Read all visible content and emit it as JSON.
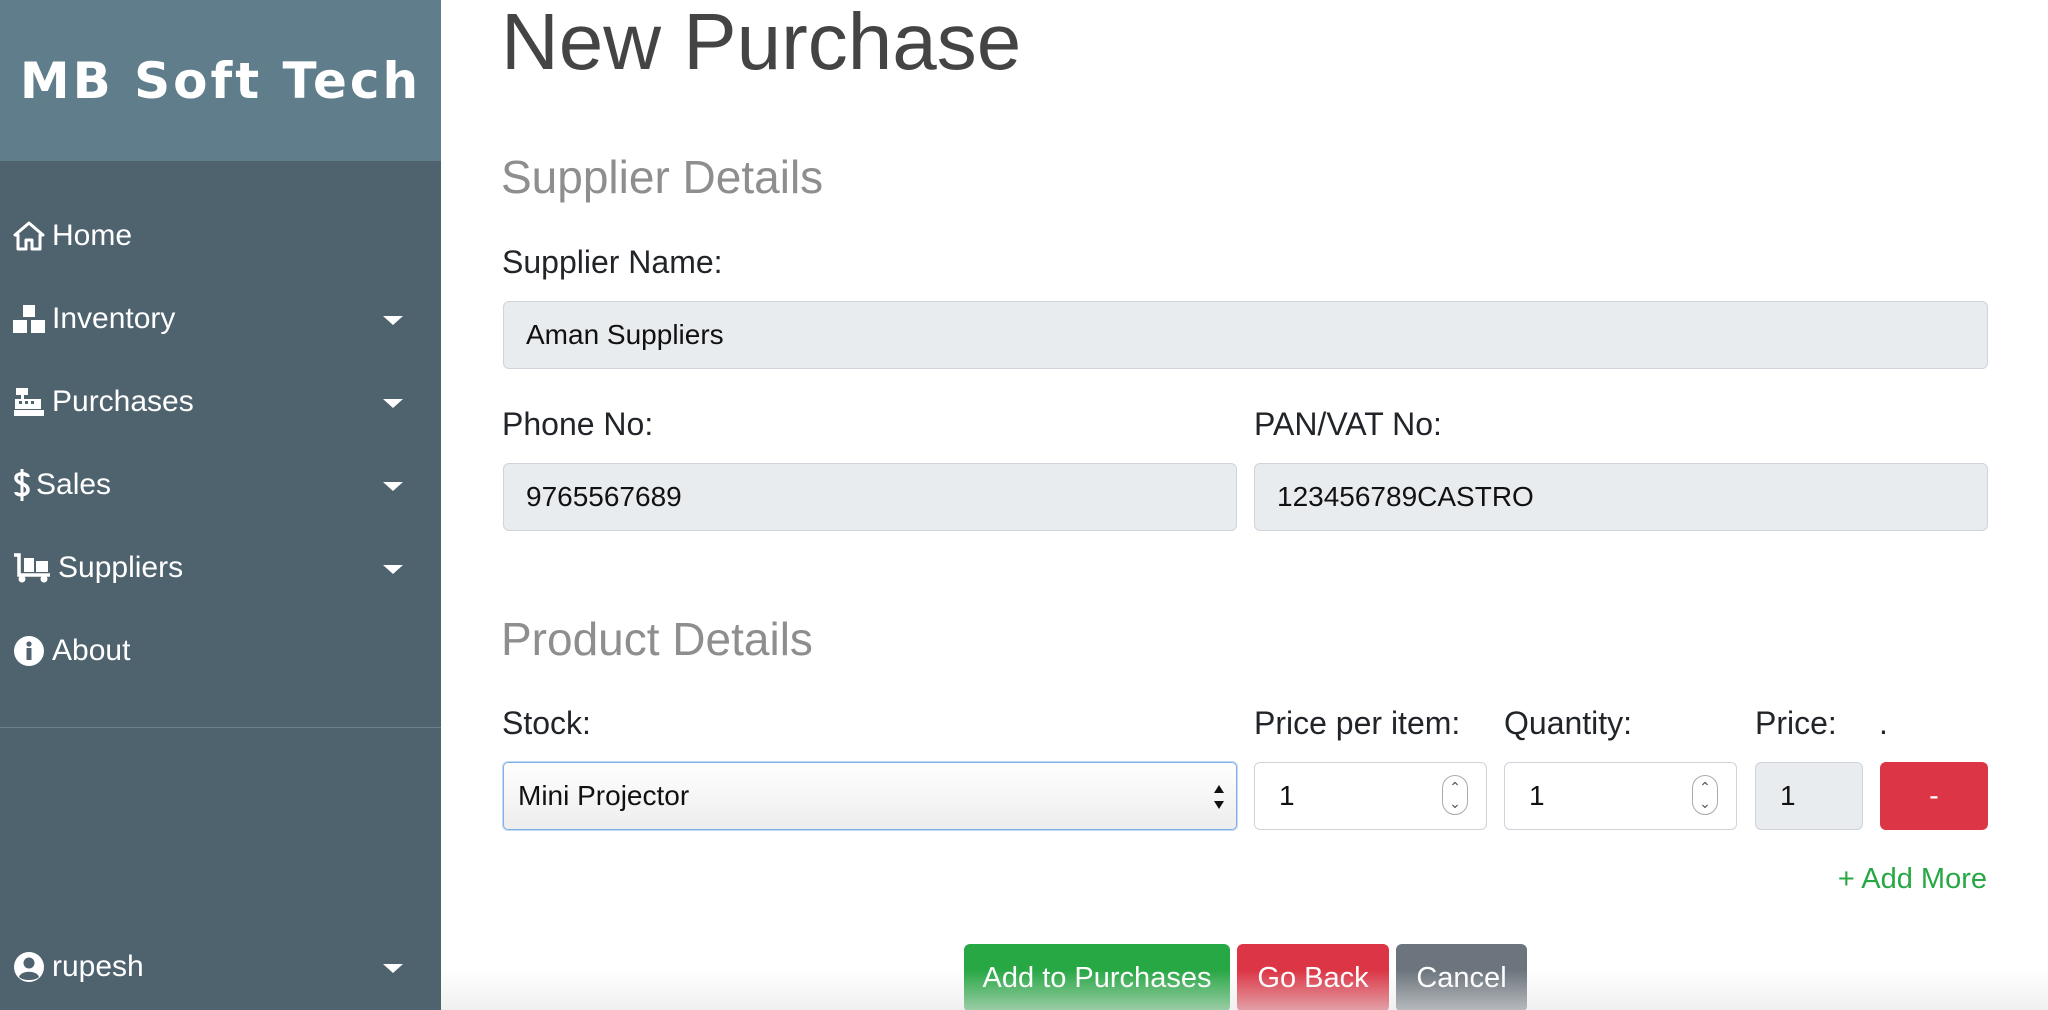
{
  "brand": {
    "name": "MB Soft Tech"
  },
  "sidebar": {
    "items": [
      {
        "label": "Home",
        "icon": "home-icon",
        "has_dropdown": false
      },
      {
        "label": "Inventory",
        "icon": "boxes-icon",
        "has_dropdown": true
      },
      {
        "label": "Purchases",
        "icon": "cash-register-icon",
        "has_dropdown": true
      },
      {
        "label": "Sales",
        "icon": "dollar-icon",
        "has_dropdown": true
      },
      {
        "label": "Suppliers",
        "icon": "dolly-icon",
        "has_dropdown": true
      },
      {
        "label": "About",
        "icon": "info-circle-icon",
        "has_dropdown": false
      }
    ],
    "user": {
      "name": "rupesh",
      "icon": "user-circle-icon"
    }
  },
  "page": {
    "title": "New Purchase"
  },
  "supplier": {
    "section_title": "Supplier Details",
    "name_label": "Supplier Name:",
    "name_value": "Aman Suppliers",
    "phone_label": "Phone No:",
    "phone_value": "9765567689",
    "pan_label": "PAN/VAT No:",
    "pan_value": "123456789CASTRO"
  },
  "product": {
    "section_title": "Product Details",
    "stock_label": "Stock:",
    "stock_value": "Mini Projector",
    "price_per_item_label": "Price per item:",
    "price_per_item_value": "1",
    "quantity_label": "Quantity:",
    "quantity_value": "1",
    "price_label": "Price:",
    "price_value": "1",
    "remove_label": ".",
    "remove_button": "-",
    "add_more": "+ Add More"
  },
  "actions": {
    "add_to_purchases": "Add to Purchases",
    "go_back": "Go Back",
    "cancel": "Cancel"
  },
  "colors": {
    "sidebar_bg": "#4f636f",
    "brand_bg": "#5f7d8b",
    "success": "#28a745",
    "danger": "#dc3545",
    "secondary": "#6c757d"
  }
}
